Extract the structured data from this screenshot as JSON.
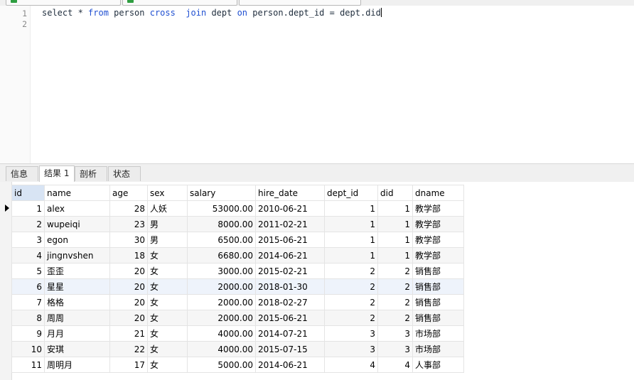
{
  "editor": {
    "line_numbers": [
      "1",
      "2"
    ],
    "query": {
      "t1": "select * ",
      "k1": "from",
      "t2": " person ",
      "k2": "cross",
      "t3": "  ",
      "k3": "join",
      "t4": " dept ",
      "k4": "on",
      "t5": " person.dept_id = dept.did"
    }
  },
  "tabs": [
    "信息",
    "结果 1",
    "剖析",
    "状态"
  ],
  "active_tab": "结果 1",
  "grid": {
    "columns": [
      "id",
      "name",
      "age",
      "sex",
      "salary",
      "hire_date",
      "dept_id",
      "did",
      "dname"
    ],
    "rows": [
      [
        "1",
        "alex",
        "28",
        "人妖",
        "53000.00",
        "2010-06-21",
        "1",
        "1",
        "教学部"
      ],
      [
        "2",
        "wupeiqi",
        "23",
        "男",
        "8000.00",
        "2011-02-21",
        "1",
        "1",
        "教学部"
      ],
      [
        "3",
        "egon",
        "30",
        "男",
        "6500.00",
        "2015-06-21",
        "1",
        "1",
        "教学部"
      ],
      [
        "4",
        "jingnvshen",
        "18",
        "女",
        "6680.00",
        "2014-06-21",
        "1",
        "1",
        "教学部"
      ],
      [
        "5",
        "歪歪",
        "20",
        "女",
        "3000.00",
        "2015-02-21",
        "2",
        "2",
        "销售部"
      ],
      [
        "6",
        "星星",
        "20",
        "女",
        "2000.00",
        "2018-01-30",
        "2",
        "2",
        "销售部"
      ],
      [
        "7",
        "格格",
        "20",
        "女",
        "2000.00",
        "2018-02-27",
        "2",
        "2",
        "销售部"
      ],
      [
        "8",
        "周周",
        "20",
        "女",
        "2000.00",
        "2015-06-21",
        "2",
        "2",
        "销售部"
      ],
      [
        "9",
        "月月",
        "21",
        "女",
        "4000.00",
        "2014-07-21",
        "3",
        "3",
        "市场部"
      ],
      [
        "10",
        "安琪",
        "22",
        "女",
        "4000.00",
        "2015-07-15",
        "3",
        "3",
        "市场部"
      ],
      [
        "11",
        "周明月",
        "17",
        "女",
        "5000.00",
        "2014-06-21",
        "4",
        "4",
        "人事部"
      ]
    ]
  },
  "colors": {
    "keyword": "#1f4fd1",
    "header_selected": "#d8e4f4",
    "row_alt": "#f6f6f6"
  },
  "icons": [
    "query-tab-icon",
    "row-pointer-icon"
  ]
}
